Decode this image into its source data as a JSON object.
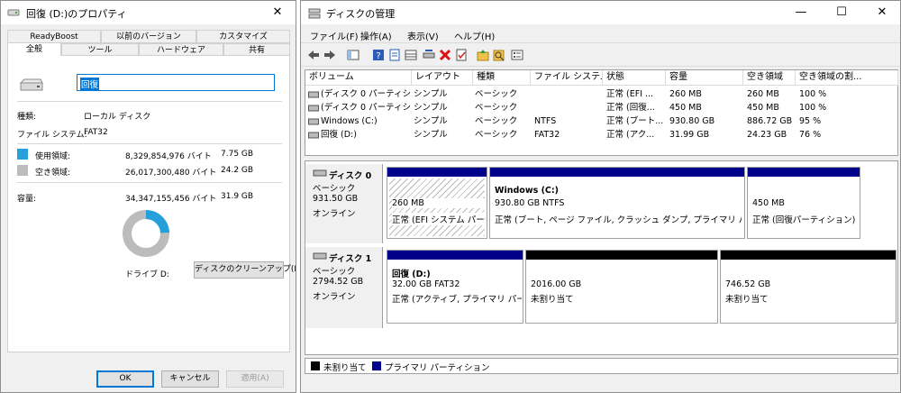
{
  "props": {
    "title": "回復 (D:)のプロパティ",
    "tabs_row1": [
      "ReadyBoost",
      "以前のバージョン",
      "カスタマイズ"
    ],
    "tabs_row2": [
      "全般",
      "ツール",
      "ハードウェア",
      "共有"
    ],
    "volume_name": "回復",
    "type_label": "種類:",
    "type_value": "ローカル ディスク",
    "fs_label": "ファイル システム:",
    "fs_value": "FAT32",
    "used_label": "使用領域:",
    "used_bytes": "8,329,854,976 バイト",
    "used_gb": "7.75 GB",
    "free_label": "空き領域:",
    "free_bytes": "26,017,300,480 バイト",
    "free_gb": "24.2 GB",
    "capacity_label": "容量:",
    "capacity_bytes": "34,347,155,456 バイト",
    "capacity_gb": "31.9 GB",
    "drive_label": "ドライブ D:",
    "cleanup_button": "ディスクのクリーンアップ(D)",
    "ok_button": "OK",
    "cancel_button": "キャンセル",
    "apply_button": "適用(A)",
    "used_fraction": 0.243,
    "colors": {
      "used": "#26a0da",
      "free": "#bcbcbc"
    }
  },
  "dm": {
    "title": "ディスクの管理",
    "menu": [
      "ファイル(F)",
      "操作(A)",
      "表示(V)",
      "ヘルプ(H)"
    ],
    "columns": [
      "ボリューム",
      "レイアウト",
      "種類",
      "ファイル システム",
      "状態",
      "容量",
      "空き領域",
      "空き領域の割..."
    ],
    "rows": [
      [
        "(ディスク 0 パーティシ...",
        "シンプル",
        "ベーシック",
        "",
        "正常 (EFI ...",
        "260 MB",
        "260 MB",
        "100 %"
      ],
      [
        "(ディスク 0 パーティシ...",
        "シンプル",
        "ベーシック",
        "",
        "正常 (回復...",
        "450 MB",
        "450 MB",
        "100 %"
      ],
      [
        "Windows (C:)",
        "シンプル",
        "ベーシック",
        "NTFS",
        "正常 (ブート...",
        "930.80 GB",
        "886.72 GB",
        "95 %"
      ],
      [
        "回復 (D:)",
        "シンプル",
        "ベーシック",
        "FAT32",
        "正常 (アク...",
        "31.99 GB",
        "24.23 GB",
        "76 %"
      ]
    ],
    "disk0": {
      "name": "ディスク 0",
      "type": "ベーシック",
      "size": "931.50 GB",
      "status": "オンライン",
      "partitions": [
        {
          "title": "",
          "size": "260 MB",
          "status": "正常 (EFI システム パーティション)"
        },
        {
          "title": "Windows (C:)",
          "size": "930.80 GB NTFS",
          "status": "正常 (ブート, ページ ファイル, クラッシュ ダンプ, プライマリ パーティション)"
        },
        {
          "title": "",
          "size": "450 MB",
          "status": "正常 (回復パーティション)"
        }
      ]
    },
    "disk1": {
      "name": "ディスク 1",
      "type": "ベーシック",
      "size": "2794.52 GB",
      "status": "オンライン",
      "partitions": [
        {
          "title": "回復 (D:)",
          "size": "32.00 GB FAT32",
          "status": "正常 (アクティブ, プライマリ パーティション)"
        },
        {
          "title": "",
          "size": "2016.00 GB",
          "status": "未割り当て"
        },
        {
          "title": "",
          "size": "746.52 GB",
          "status": "未割り当て"
        }
      ]
    },
    "legend": {
      "unallocated": "未割り当て",
      "primary": "プライマリ パーティション"
    },
    "colors": {
      "primary": "#00008b",
      "unallocated": "#000000"
    }
  }
}
